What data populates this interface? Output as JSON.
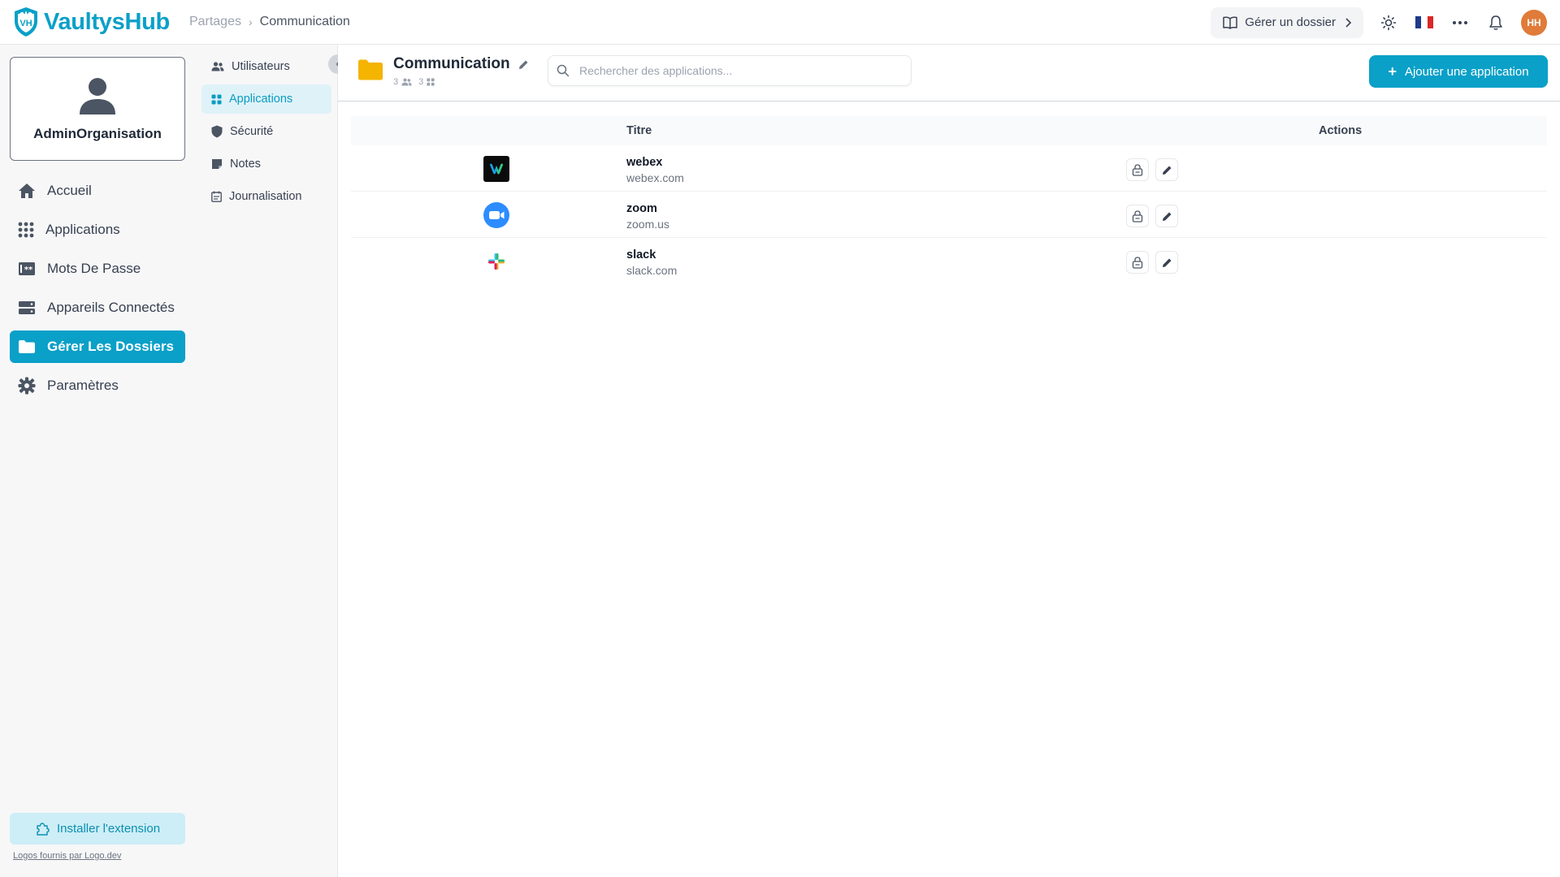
{
  "header": {
    "logo_text": "VaultysHub",
    "logo_mark": "VH",
    "breadcrumb": [
      "Partages",
      "Communication"
    ],
    "manage_folder_label": "Gérer un dossier",
    "avatar_initials": "HH",
    "icons": [
      "book-open-icon",
      "chevron-right-icon",
      "sun-icon",
      "french-flag-icon",
      "more-horizontal-icon",
      "bell-icon"
    ],
    "colors": {
      "brand": "#0aa0c8",
      "avatar": "#e07b39"
    }
  },
  "sidebar": {
    "profile_name": "AdminOrganisation",
    "items": [
      {
        "label": "Accueil",
        "icon": "home-icon",
        "active": false
      },
      {
        "label": "Applications",
        "icon": "grid-icon",
        "active": false
      },
      {
        "label": "Mots De Passe",
        "icon": "password-icon",
        "active": false
      },
      {
        "label": "Appareils Connectés",
        "icon": "devices-icon",
        "active": false
      },
      {
        "label": "Gérer Les Dossiers",
        "icon": "folder-icon",
        "active": true
      },
      {
        "label": "Paramètres",
        "icon": "gear-icon",
        "active": false
      }
    ],
    "install_label": "Installer l'extension",
    "logos_credit": "Logos fournis par Logo.dev"
  },
  "subnav": {
    "items": [
      {
        "label": "Utilisateurs",
        "icon": "users-icon",
        "active": false
      },
      {
        "label": "Applications",
        "icon": "grid-icon",
        "active": true
      },
      {
        "label": "Sécurité",
        "icon": "shield-icon",
        "active": false
      },
      {
        "label": "Notes",
        "icon": "note-icon",
        "active": false
      },
      {
        "label": "Journalisation",
        "icon": "calendar-log-icon",
        "active": false
      }
    ]
  },
  "main": {
    "folder_title": "Communication",
    "users_count": "3",
    "apps_count": "3",
    "search_placeholder": "Rechercher des applications...",
    "add_button_label": "Ajouter une application",
    "columns": {
      "title": "Titre",
      "actions": "Actions"
    },
    "apps": [
      {
        "name": "webex",
        "domain": "webex.com",
        "logo": "webex-logo"
      },
      {
        "name": "zoom",
        "domain": "zoom.us",
        "logo": "zoom-logo"
      },
      {
        "name": "slack",
        "domain": "slack.com",
        "logo": "slack-logo"
      }
    ]
  }
}
